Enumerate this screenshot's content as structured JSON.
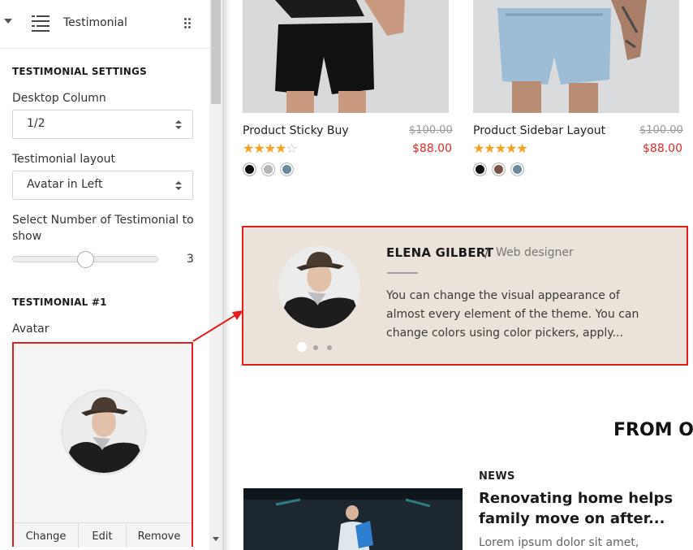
{
  "panel": {
    "title": "Testimonial",
    "settings_heading": "TESTIMONIAL SETTINGS",
    "desktop_column": {
      "label": "Desktop Column",
      "value": "1/2"
    },
    "layout": {
      "label": "Testimonial layout",
      "value": "Avatar in Left"
    },
    "count": {
      "label_line1": "Select Number of Testimonial to",
      "label_line2": "show",
      "value": "3",
      "slider_fraction": 0.5
    },
    "item_heading": "TESTIMONIAL #1",
    "avatar": {
      "label": "Avatar",
      "change": "Change",
      "edit": "Edit",
      "remove": "Remove"
    }
  },
  "products": [
    {
      "title": "Product Sticky Buy",
      "old_price": "$100.00",
      "price": "$88.00",
      "rating": 4,
      "swatches": [
        "#0d0d0d",
        "#b3b3b3",
        "#6c8a99"
      ]
    },
    {
      "title": "Product Sidebar Layout",
      "old_price": "$100.00",
      "price": "$88.00",
      "rating": 5,
      "swatches": [
        "#0d0d0d",
        "#7a5546",
        "#6c8a99"
      ]
    }
  ],
  "testimonial": {
    "name": "ELENA GILBERT",
    "separator": "/",
    "role": "Web designer",
    "text_line1": "You can change the visual appearance of",
    "text_line2": "almost every element of the theme. You can",
    "text_line3": "change colors using color pickers, apply...",
    "background": "#ebe3da",
    "dots": 3,
    "active_dot": 1
  },
  "blog": {
    "heading": "FROM OU",
    "tag": "NEWS",
    "title_line1": "Renovating home helps",
    "title_line2": "family move on after...",
    "excerpt": "Lorem ipsum dolor sit amet,"
  },
  "colors": {
    "highlight": "#e41e1e",
    "price": "#e62727",
    "star": "#f7a21b"
  }
}
